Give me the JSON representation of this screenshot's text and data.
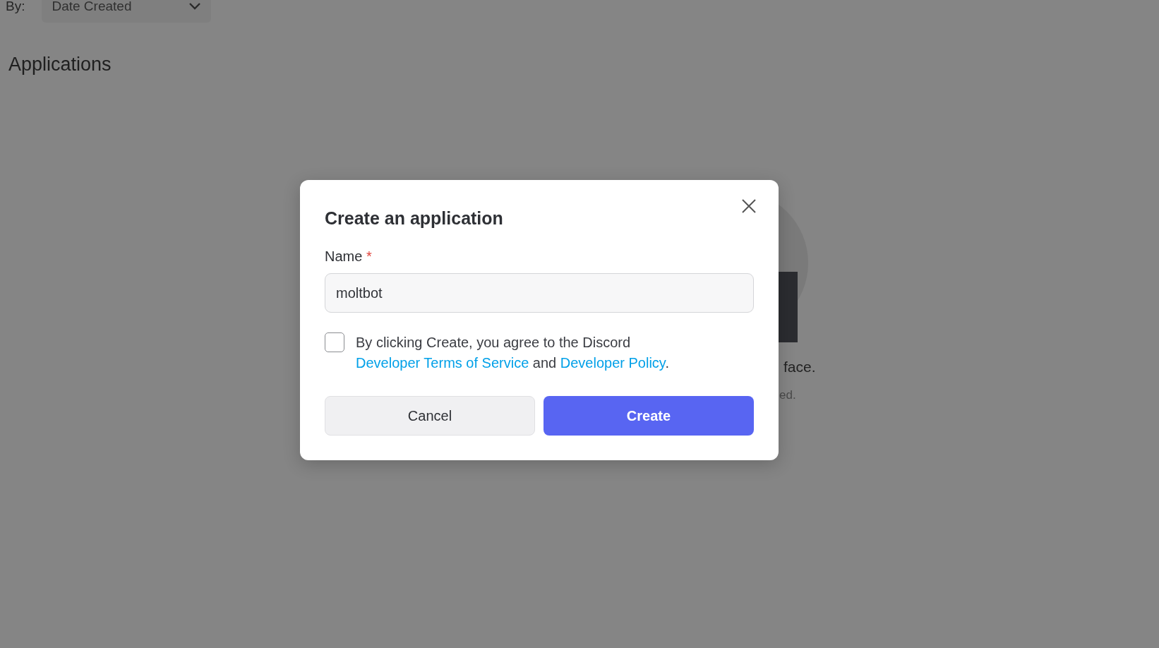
{
  "background": {
    "sort_label": "By:",
    "sort_value": "Date Created",
    "heading": "Applications",
    "empty_title": "face.",
    "empty_note": "ed."
  },
  "dialog": {
    "title": "Create an application",
    "name_label": "Name",
    "required_mark": "*",
    "name_value": "moltbot",
    "agree_checked": false,
    "agree_text": [
      {
        "kind": "plain",
        "text": "By clicking Create, you agree to the Discord "
      },
      {
        "kind": "link",
        "text": "Developer Terms of Service"
      },
      {
        "kind": "plain",
        "text": " and "
      },
      {
        "kind": "link",
        "text": "Developer Policy"
      },
      {
        "kind": "plain",
        "text": "."
      }
    ],
    "buttons": [
      {
        "kind": "secondary",
        "label": "Cancel"
      },
      {
        "kind": "primary",
        "label": "Create"
      }
    ]
  }
}
